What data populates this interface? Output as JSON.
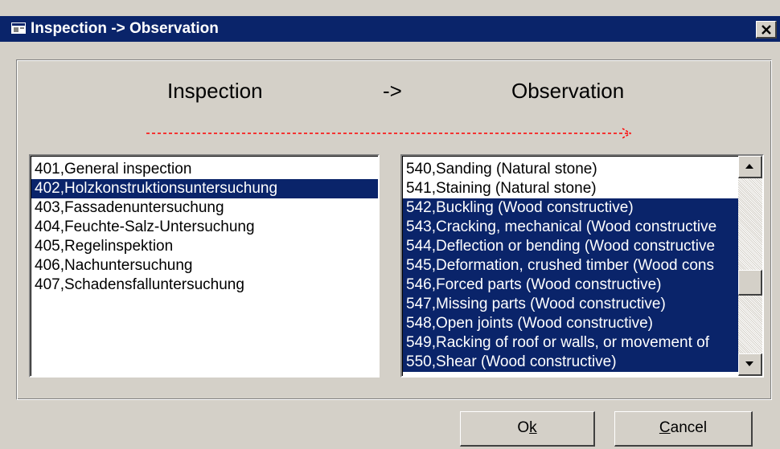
{
  "window": {
    "title": "Inspection -> Observation",
    "close_label": "✕"
  },
  "header": {
    "left": "Inspection",
    "arrow": "->",
    "right": "Observation"
  },
  "inspection_list": {
    "items": [
      {
        "label": "401,General inspection",
        "selected": false
      },
      {
        "label": "402,Holzkonstruktionsuntersuchung",
        "selected": true
      },
      {
        "label": "403,Fassadenuntersuchung",
        "selected": false
      },
      {
        "label": "404,Feuchte-Salz-Untersuchung",
        "selected": false
      },
      {
        "label": "405,Regelinspektion",
        "selected": false
      },
      {
        "label": "406,Nachuntersuchung",
        "selected": false
      },
      {
        "label": "407,Schadensfalluntersuchung",
        "selected": false
      }
    ]
  },
  "observation_list": {
    "items": [
      {
        "label": "540,Sanding (Natural stone)",
        "selected": false
      },
      {
        "label": "541,Staining (Natural stone)",
        "selected": false
      },
      {
        "label": "542,Buckling (Wood constructive)",
        "selected": true
      },
      {
        "label": "543,Cracking, mechanical (Wood constructive",
        "selected": true
      },
      {
        "label": "544,Deflection or bending (Wood constructive",
        "selected": true
      },
      {
        "label": "545,Deformation, crushed timber (Wood cons",
        "selected": true
      },
      {
        "label": "546,Forced parts (Wood constructive)",
        "selected": true
      },
      {
        "label": "547,Missing parts (Wood constructive)",
        "selected": true
      },
      {
        "label": "548,Open joints (Wood constructive)",
        "selected": true
      },
      {
        "label": "549,Racking of roof or walls, or movement of",
        "selected": true
      },
      {
        "label": "550,Shear (Wood constructive)",
        "selected": true
      }
    ]
  },
  "buttons": {
    "ok_pre": "O",
    "ok_accel": "k",
    "ok_post": "",
    "cancel_pre": "",
    "cancel_accel": "C",
    "cancel_post": "ancel"
  },
  "colors": {
    "titlebar": "#0a246a",
    "selection": "#0a246a",
    "arrow": "#ff0000",
    "face": "#d4d0c8"
  },
  "icons": {
    "app": "window-icon",
    "close": "close-icon",
    "scroll_up": "arrow-up-icon",
    "scroll_down": "arrow-down-icon"
  }
}
